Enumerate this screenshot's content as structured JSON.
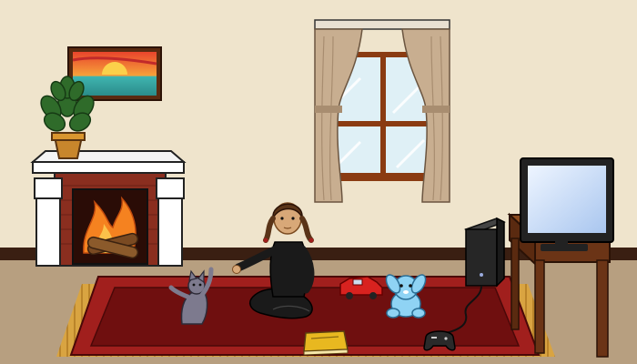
{
  "scene": {
    "colors": {
      "wall": "#efe4cc",
      "baseboard": "#3a1f12",
      "floor": "#b79f80",
      "rug_fringe": "#d9a441",
      "rug_border": "#a11f1d",
      "rug_inner": "#6f0f0f",
      "mantel": "#ffffff",
      "brick": "#8a2e1f",
      "fire": "#f58220",
      "window_frame": "#8a3b12",
      "glass": "#dff0f6",
      "curtain": "#c8ae90",
      "tv_screen": "#c7dcf5",
      "desk": "#6b3416",
      "console": "#262626",
      "girl_outfit": "#1a1a1a",
      "cat": "#7d7a8e",
      "bunny": "#8fd3f4",
      "toy_car": "#d8221f",
      "book": "#e8b820",
      "plant": "#2f6b2a",
      "pot": "#c8862c"
    },
    "objects": [
      {
        "id": "painting",
        "icon": "sunset-painting-icon"
      },
      {
        "id": "plant",
        "icon": "potted-plant-icon"
      },
      {
        "id": "fireplace",
        "icon": "fireplace-icon"
      },
      {
        "id": "window",
        "icon": "curtained-window-icon"
      },
      {
        "id": "tv",
        "icon": "television-icon"
      },
      {
        "id": "desk",
        "icon": "wooden-desk-icon"
      },
      {
        "id": "console",
        "icon": "game-console-icon"
      },
      {
        "id": "controller",
        "icon": "gamepad-icon"
      },
      {
        "id": "girl",
        "icon": "girl-character-icon"
      },
      {
        "id": "cat",
        "icon": "gray-cat-icon"
      },
      {
        "id": "toy_car",
        "icon": "red-toy-car-icon"
      },
      {
        "id": "bunny",
        "icon": "blue-plush-bunny-icon"
      },
      {
        "id": "book",
        "icon": "book-icon"
      }
    ]
  }
}
